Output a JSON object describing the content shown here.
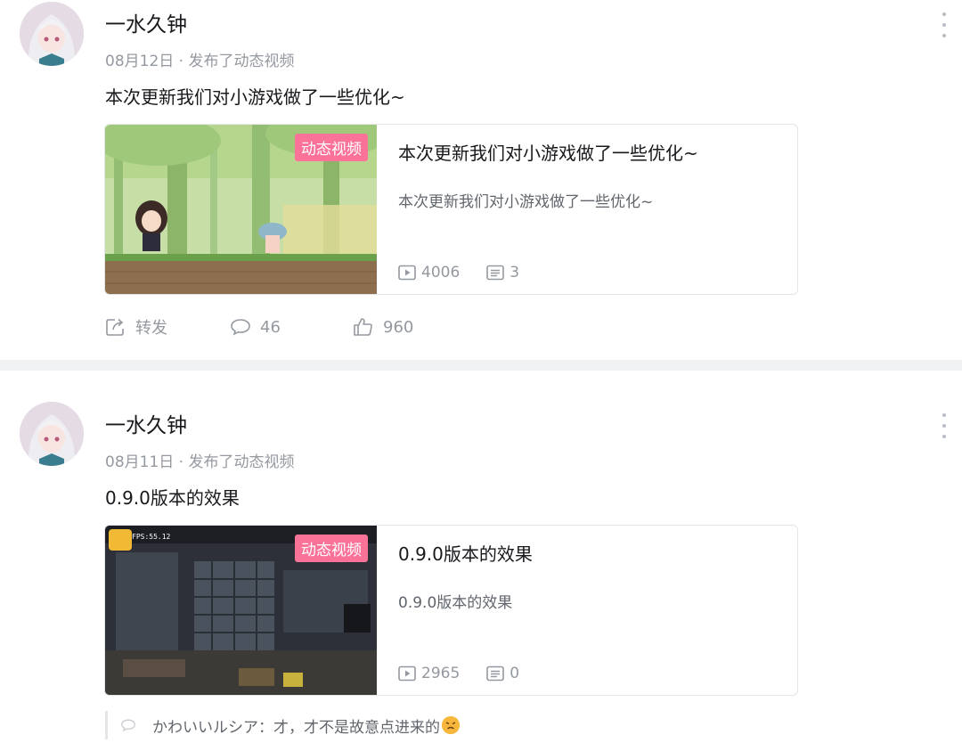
{
  "posts": [
    {
      "author": "一水久钟",
      "meta": "08月12日 · 发布了动态视频",
      "content": "本次更新我们对小游戏做了一些优化~",
      "card": {
        "badge": "动态视频",
        "title": "本次更新我们对小游戏做了一些优化~",
        "desc": "本次更新我们对小游戏做了一些优化~",
        "plays": "4006",
        "danmaku": "3"
      },
      "actions": {
        "share": "转发",
        "comments": "46",
        "likes": "960"
      }
    },
    {
      "author": "一水久钟",
      "meta": "08月11日 · 发布了动态视频",
      "content": "0.9.0版本的效果",
      "card": {
        "badge": "动态视频",
        "title": "0.9.0版本的效果",
        "desc": "0.9.0版本的效果",
        "plays": "2965",
        "danmaku": "0"
      },
      "comment_preview": "かわいいルシア：才，才不是故意点进来的"
    }
  ],
  "icons": {
    "more": "more-vertical-icon",
    "play": "play-icon",
    "danmaku": "danmaku-icon",
    "share": "share-icon",
    "comment": "comment-icon",
    "like": "thumbs-up-icon",
    "emoji": "emoji-icon"
  },
  "colors": {
    "badge": "#fb7299",
    "muted": "#9499a0",
    "divider": "#f1f2f3"
  }
}
